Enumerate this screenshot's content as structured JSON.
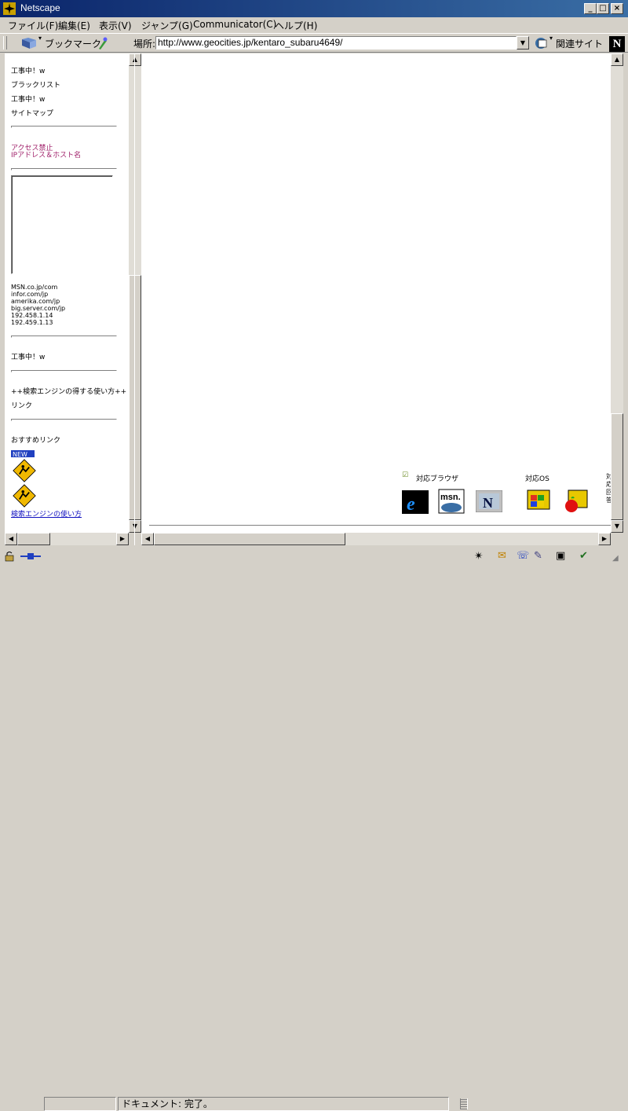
{
  "window": {
    "title": "Netscape"
  },
  "menu": [
    "ファイル(F)",
    "編集(E)",
    "表示(V)",
    "ジャンプ(G)",
    "Communicator(C)",
    "ヘルプ(H)"
  ],
  "toolbar": {
    "bookmarks_label": "ブックマーク",
    "location_label": "場所:",
    "url": "http://www.geocities.jp/kentaro_subaru4649/",
    "related_label": "関連サイト"
  },
  "sidebar": {
    "items": [
      "工事中！w",
      "ブラックリスト",
      "工事中！w",
      "サイトマップ"
    ],
    "warning_lines": [
      "アクセス禁止",
      "IPアドレス＆ホスト名"
    ],
    "host_list": [
      "MSN.co.jp/com",
      "infor.com/jp",
      "amerika.com/jp",
      "big.server.com/jp",
      "192.458.1.14",
      "192.459.1.13"
    ],
    "under_construction": "工事中！w",
    "search_tips": "++検索エンジンの得する使い方++",
    "links": "リンク",
    "recommended": "おすすめリンク",
    "search_usage_link": "検索エンジンの使い方"
  },
  "main": {
    "browsers_label": "対応ブラウザ",
    "os_label": "対応OS"
  },
  "status": {
    "text": "ドキュメント: 完了。"
  }
}
